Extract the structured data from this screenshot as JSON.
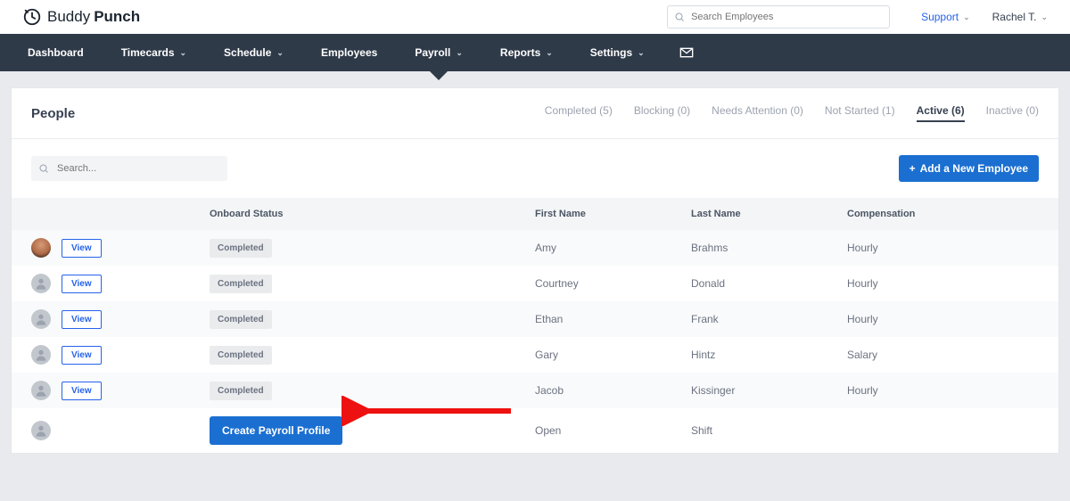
{
  "brand": {
    "light": "Buddy",
    "bold": "Punch"
  },
  "header": {
    "search_placeholder": "Search Employees",
    "support_label": "Support",
    "user_name": "Rachel T."
  },
  "nav": {
    "items": [
      {
        "label": "Dashboard",
        "chev": false,
        "active": false
      },
      {
        "label": "Timecards",
        "chev": true,
        "active": false
      },
      {
        "label": "Schedule",
        "chev": true,
        "active": false
      },
      {
        "label": "Employees",
        "chev": false,
        "active": false
      },
      {
        "label": "Payroll",
        "chev": true,
        "active": true
      },
      {
        "label": "Reports",
        "chev": true,
        "active": false
      },
      {
        "label": "Settings",
        "chev": true,
        "active": false
      }
    ]
  },
  "page": {
    "title": "People",
    "search_placeholder": "Search...",
    "add_button_label": "Add a New Employee",
    "status_tabs": [
      {
        "label": "Completed (5)",
        "active": false
      },
      {
        "label": "Blocking (0)",
        "active": false
      },
      {
        "label": "Needs Attention (0)",
        "active": false
      },
      {
        "label": "Not Started (1)",
        "active": false
      },
      {
        "label": "Active (6)",
        "active": true
      },
      {
        "label": "Inactive (0)",
        "active": false
      }
    ],
    "columns": {
      "onboard": "Onboard Status",
      "first": "First Name",
      "last": "Last Name",
      "comp": "Compensation"
    },
    "rows": [
      {
        "photo": true,
        "view": true,
        "status_type": "badge",
        "status_text": "Completed",
        "first": "Amy",
        "last": "Brahms",
        "comp": "Hourly"
      },
      {
        "photo": false,
        "view": true,
        "status_type": "badge",
        "status_text": "Completed",
        "first": "Courtney",
        "last": "Donald",
        "comp": "Hourly"
      },
      {
        "photo": false,
        "view": true,
        "status_type": "badge",
        "status_text": "Completed",
        "first": "Ethan",
        "last": "Frank",
        "comp": "Hourly"
      },
      {
        "photo": false,
        "view": true,
        "status_type": "badge",
        "status_text": "Completed",
        "first": "Gary",
        "last": "Hintz",
        "comp": "Salary"
      },
      {
        "photo": false,
        "view": true,
        "status_type": "badge",
        "status_text": "Completed",
        "first": "Jacob",
        "last": "Kissinger",
        "comp": "Hourly"
      },
      {
        "photo": false,
        "view": false,
        "status_type": "button",
        "status_text": "Create Payroll Profile",
        "first": "Open",
        "last": "Shift",
        "comp": ""
      }
    ],
    "view_label": "View"
  }
}
